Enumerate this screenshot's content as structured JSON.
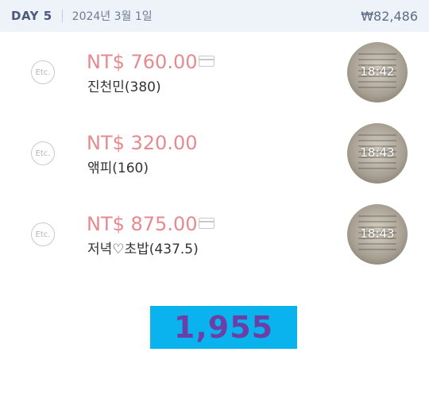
{
  "header": {
    "day_label": "DAY 5",
    "date": "2024년 3월 1일",
    "total": "₩82,486"
  },
  "items": [
    {
      "category": "Etc.",
      "amount": "NT$ 760.00",
      "memo": "진천민(380)",
      "time": "18:42",
      "card": true
    },
    {
      "category": "Etc.",
      "amount": "NT$ 320.00",
      "memo": "앢피(160)",
      "time": "18:43",
      "card": false
    },
    {
      "category": "Etc.",
      "amount": "NT$ 875.00",
      "memo": "저녁♡초밥(437.5)",
      "time": "18:43",
      "card": true
    }
  ],
  "sum_overlay": "1,955",
  "colors": {
    "header_bg": "#eef3fa",
    "amount": "#e58a8e",
    "overlay_bg": "#0bb3ee",
    "overlay_text": "#6c3fa8"
  }
}
